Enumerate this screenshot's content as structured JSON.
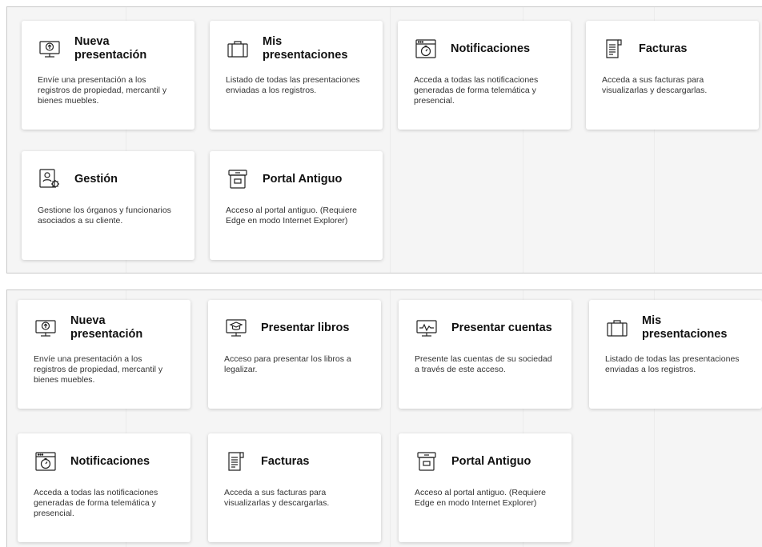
{
  "panel_1": {
    "cards": [
      {
        "icon": "monitor-upload-icon",
        "title": "Nueva presentación",
        "description": "Envíe una presentación a los registros de propiedad, mercantil y bienes muebles."
      },
      {
        "icon": "briefcase-icon",
        "title": "Mis presentaciones",
        "description": "Listado de todas las presentaciones enviadas a los registros."
      },
      {
        "icon": "browser-timer-icon",
        "title": "Notificaciones",
        "description": "Acceda a todas las notificaciones generadas de forma telemática y presencial."
      },
      {
        "icon": "invoice-document-icon",
        "title": "Facturas",
        "description": "Acceda a sus facturas para visualizarlas y descargarlas."
      },
      {
        "icon": "profile-gear-icon",
        "title": "Gestión",
        "description": "Gestione los órganos y funcionarios asociados a su cliente."
      },
      {
        "icon": "archive-box-icon",
        "title": "Portal Antiguo",
        "description": "Acceso al portal antiguo. (Requiere Edge en modo Internet Explorer)"
      }
    ]
  },
  "panel_2": {
    "cards": [
      {
        "icon": "monitor-upload-icon",
        "title": "Nueva presentación",
        "description": "Envíe una presentación a los registros de propiedad, mercantil y bienes muebles."
      },
      {
        "icon": "monitor-graduation-icon",
        "title": "Presentar libros",
        "description": "Acceso para presentar los libros a legalizar."
      },
      {
        "icon": "monitor-chart-icon",
        "title": "Presentar cuentas",
        "description": "Presente las cuentas de su sociedad a través de este acceso."
      },
      {
        "icon": "briefcase-icon",
        "title": "Mis presentaciones",
        "description": "Listado de todas las presentaciones enviadas a los registros."
      },
      {
        "icon": "browser-timer-icon",
        "title": "Notificaciones",
        "description": "Acceda a todas las notificaciones generadas de forma telemática y presencial."
      },
      {
        "icon": "invoice-document-icon",
        "title": "Facturas",
        "description": "Acceda a sus facturas para visualizarlas y descargarlas."
      },
      {
        "icon": "archive-box-icon",
        "title": "Portal Antiguo",
        "description": "Acceso al portal antiguo. (Requiere Edge en modo Internet Explorer)"
      }
    ]
  }
}
